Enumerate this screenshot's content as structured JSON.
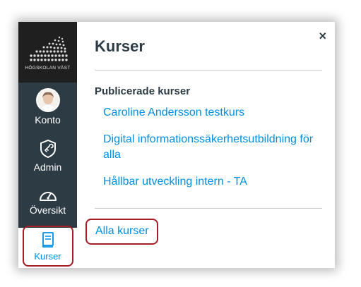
{
  "logo": {
    "text": "HÖGSKOLAN VÄST"
  },
  "sidebar": {
    "items": [
      {
        "label": "Konto",
        "icon": "user-avatar"
      },
      {
        "label": "Admin",
        "icon": "shield-icon"
      },
      {
        "label": "Översikt",
        "icon": "speedometer-icon"
      },
      {
        "label": "Kurser",
        "icon": "book-icon",
        "active": true
      }
    ]
  },
  "panel": {
    "title": "Kurser",
    "close_label": "×",
    "section_heading": "Publicerade kurser",
    "courses": [
      "Caroline Andersson testkurs",
      "Digital informationssäkerhetsutbildning för alla",
      "Hållbar utveckling intern - TA"
    ],
    "all_courses_label": "Alla kurser"
  },
  "colors": {
    "sidebar_bg": "#2d3b45",
    "link": "#008ee2",
    "highlight": "#a51d24"
  }
}
